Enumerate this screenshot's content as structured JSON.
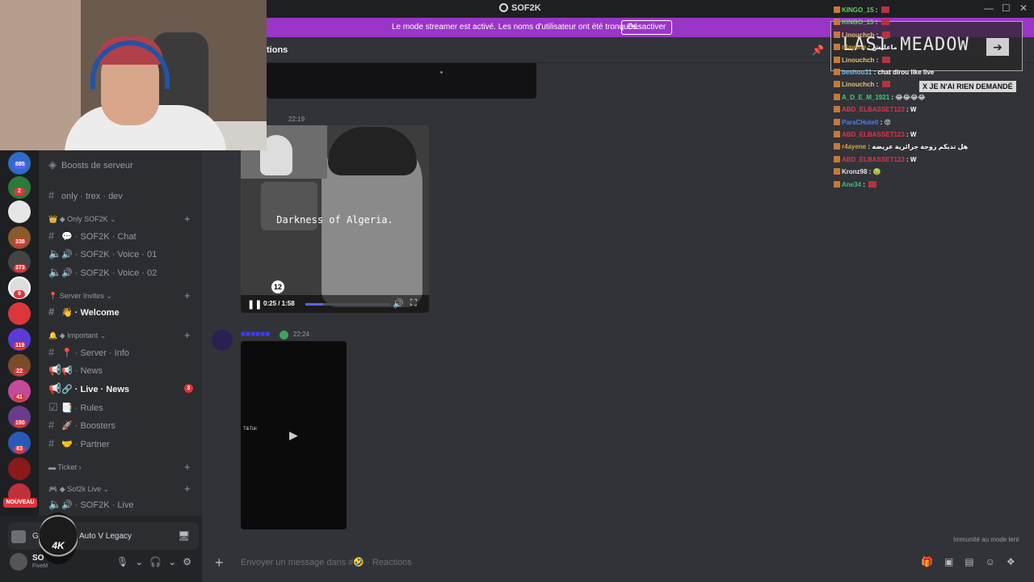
{
  "window": {
    "title": "SOF2K",
    "controls": [
      "—",
      "☐",
      "✕"
    ]
  },
  "banner": {
    "text": "Le mode streamer est activé. Les noms d'utilisateur ont été tronqués.",
    "button": "Désactiver"
  },
  "channel_header": {
    "name_fragment": "tions"
  },
  "messages": [
    {
      "time": "22:19",
      "video": {
        "caption": "Darkness of Algeria.",
        "age_rating": "12",
        "time": "0:25 / 1:58",
        "progress": 0.21
      }
    },
    {
      "time": "22:24",
      "video": {
        "source": "TikTok"
      }
    }
  ],
  "slowmode": "Immunité au mode lent",
  "input": {
    "placeholder": "Envoyer un message dans #🤣 · Reactions"
  },
  "servers": {
    "badges": [
      "685",
      "2",
      "338",
      "373",
      "9",
      "119",
      "22",
      "41",
      "190",
      "83"
    ],
    "new_label": "NOUVEAU"
  },
  "channels": {
    "items": [
      {
        "label": "Boosts de serveur",
        "kind": "boost"
      },
      {
        "label": "only · trex · dev",
        "kind": "text"
      },
      {
        "label": "Only SOF2K",
        "kind": "category"
      },
      {
        "label": "💬 · SOF2K · Chat",
        "kind": "text"
      },
      {
        "label": "🔊 · SOF2K · Voice · 01",
        "kind": "voice"
      },
      {
        "label": "🔊 · SOF2K · Voice · 02",
        "kind": "voice"
      },
      {
        "label": "Server Invites",
        "kind": "category"
      },
      {
        "label": "👋 · Welcome",
        "kind": "text"
      },
      {
        "label": "Important",
        "kind": "category"
      },
      {
        "label": "📍 · Server · Info",
        "kind": "text"
      },
      {
        "label": "📢 · News",
        "kind": "announce"
      },
      {
        "label": "🔗 · Live · News",
        "kind": "announce",
        "badge": "3"
      },
      {
        "label": "📑 · Rules",
        "kind": "rules"
      },
      {
        "label": "🚀 · Boosters",
        "kind": "text"
      },
      {
        "label": "🤝 · Partner",
        "kind": "text"
      },
      {
        "label": "Ticket",
        "kind": "category"
      },
      {
        "label": "Sof2k Live",
        "kind": "category"
      },
      {
        "label": "🔊 · SOF2K · Live",
        "kind": "voice"
      }
    ]
  },
  "user_panel": {
    "activity_prefix": "G",
    "activity": "Auto V Legacy",
    "username": "SO",
    "status": "FiveM",
    "logo_text": "4K"
  },
  "overlay": {
    "last_meadow": "LAST MEADOW",
    "arrow": "➔",
    "not_asked": "X JE N'AI RIEN DEMANDÉ",
    "chat": [
      {
        "user": "KINGO_15",
        "color": "#5fd35f",
        "msg": ""
      },
      {
        "user": "KINGO_15",
        "color": "#5fd35f",
        "msg": ""
      },
      {
        "user": "Linouchch",
        "color": "#e3c07a",
        "msg": ""
      },
      {
        "user": "r4ayene",
        "color": "#d8a53a",
        "msg": "ماعليش"
      },
      {
        "user": "Linouchch",
        "color": "#e3c07a",
        "msg": ""
      },
      {
        "user": "beshou31",
        "color": "#6ec1ff",
        "msg": "chat dirou like live"
      },
      {
        "user": "Linouchch",
        "color": "#e3c07a",
        "msg": ""
      },
      {
        "user": "A_D_E_M_1921",
        "color": "#3ed07a",
        "msg": "😂😂😂😂"
      },
      {
        "user": "ABD_ELBASSET123",
        "color": "#e0354a",
        "msg": "W"
      },
      {
        "user": "ParaCHute0",
        "color": "#4f7ef0",
        "msg": "😡"
      },
      {
        "user": "ABD_ELBASSET123",
        "color": "#e0354a",
        "msg": "W"
      },
      {
        "user": "r4ayene",
        "color": "#d8a53a",
        "msg": "هل تديكم زوجة جزائرية عريضة"
      },
      {
        "user": "ABD_ELBASSET123",
        "color": "#e0354a",
        "msg": "W"
      },
      {
        "user": "Kronz98",
        "color": "#e6e6e6",
        "msg": "🤢"
      },
      {
        "user": "Ane34",
        "color": "#3ec07a",
        "msg": ""
      }
    ]
  },
  "colors": {
    "banner": "#9b35c8",
    "chat_bg": "#313338",
    "sidebar_bg": "#2b2d31",
    "accent": "#5865f2",
    "badge_red": "#da373c"
  }
}
